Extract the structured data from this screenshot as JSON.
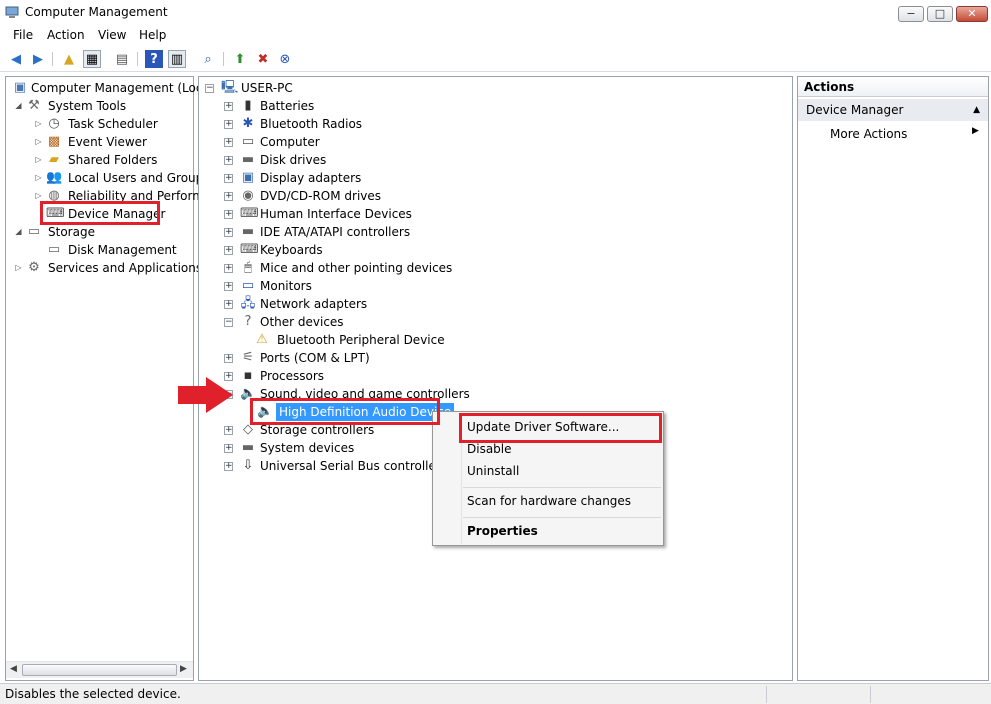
{
  "window": {
    "title": "Computer Management",
    "min": "−",
    "max": "□",
    "close": "✕"
  },
  "menus": [
    "File",
    "Action",
    "View",
    "Help"
  ],
  "toolbar_icons": [
    "back-icon",
    "forward-icon",
    "up-folder-icon",
    "show-hide-tree-icon",
    "properties-icon",
    "help-icon",
    "show-action-pane-icon",
    "scan-hardware-icon",
    "update-driver-icon",
    "disable-device-icon",
    "uninstall-device-icon"
  ],
  "left_tree": {
    "root": "Computer Management (Local",
    "system_tools": "System Tools",
    "items": [
      "Task Scheduler",
      "Event Viewer",
      "Shared Folders",
      "Local Users and Groups",
      "Reliability and Performa",
      "Device Manager"
    ],
    "storage": "Storage",
    "disk_management": "Disk Management",
    "services": "Services and Applications"
  },
  "device_tree": {
    "root": "USER-PC",
    "categories": [
      "Batteries",
      "Bluetooth Radios",
      "Computer",
      "Disk drives",
      "Display adapters",
      "DVD/CD-ROM drives",
      "Human Interface Devices",
      "IDE ATA/ATAPI controllers",
      "Keyboards",
      "Mice and other pointing devices",
      "Monitors",
      "Network adapters",
      "Other devices",
      "Bluetooth Peripheral Device",
      "Ports (COM & LPT)",
      "Processors",
      "Sound, video and game controllers",
      "High Definition Audio Device",
      "Storage controllers",
      "System devices",
      "Universal Serial Bus controllers"
    ]
  },
  "context_menu": {
    "update": "Update Driver Software...",
    "disable": "Disable",
    "uninstall": "Uninstall",
    "scan": "Scan for hardware changes",
    "properties": "Properties"
  },
  "actions": {
    "header": "Actions",
    "device_manager": "Device Manager",
    "more_actions": "More Actions"
  },
  "status": {
    "text": "Disables the selected device."
  },
  "colors": {
    "highlight": "#e0202a",
    "selection": "#3399ff"
  }
}
